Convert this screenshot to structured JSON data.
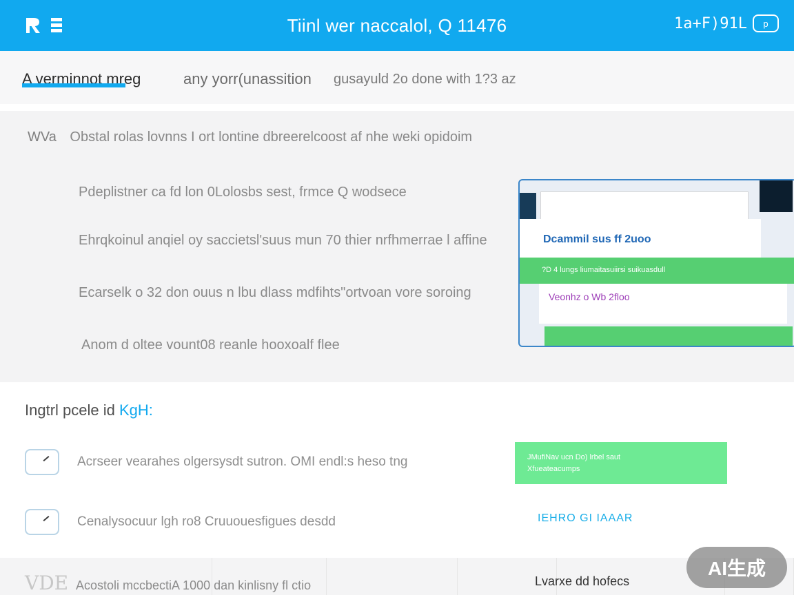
{
  "header": {
    "title": "Tiinl wer naccalol, Q 11476",
    "right_text": "1a+F)91L",
    "right_pill": "p"
  },
  "subheader": {
    "left_text": "A verminnot mreg",
    "middle_text": "any yorr(unassition",
    "right_text": "gusayuld 2o done  with 1?3 az"
  },
  "main": {
    "intro_label": "WVa",
    "intro_text": "Obstal rolas lovnns I ort lontine dbreerelcoost af nhe weki opidoim",
    "lines": [
      "Pdeplistner ca fd lon 0Lolosbs sest, frmce Q wodsece",
      "Ehrqkoinul anqiel oy saccietsl'suus mun 70 thier nrfhmerrae l affine",
      "Ecarselk o 32 don ouus n lbu dlass mdfihts\"ortvoan vore soroing",
      "Anom d oltee vount08 reanle hooxoalf flee"
    ],
    "preview": {
      "title": "Dcammil sus ff 2uoo",
      "strip": "?D 4 lungs liumaitasuiirsi suikuasdull",
      "line": "Veonhz o Wb 2floo"
    }
  },
  "section2": {
    "title_prefix": "Ingtrl pcele id",
    "title_accent": "KgH:",
    "items": [
      "Acrseer vearahes olgersysdt sutron. OMI endl:s heso tng",
      "Cenalysocuur lgh ro8 Cruuouesfigues desdd"
    ],
    "green_tag_line1": "JMufiNav ucn Do) lrbel saut",
    "green_tag_line2": "Xfueateacumps",
    "blue_hint": "IEHRO GI IAAAR"
  },
  "bottom": {
    "left_icon_text": "VDE",
    "left_text": "Acostoli mccbectiA 1000 dan kinlisny fl ctio",
    "right_text": "Lvarxe dd hofecs"
  },
  "badge": {
    "text": "AI生成"
  },
  "colors": {
    "header": "#11a9ef",
    "green": "#56cf72",
    "light_green": "#6eea94",
    "accent": "#11a9ef"
  }
}
